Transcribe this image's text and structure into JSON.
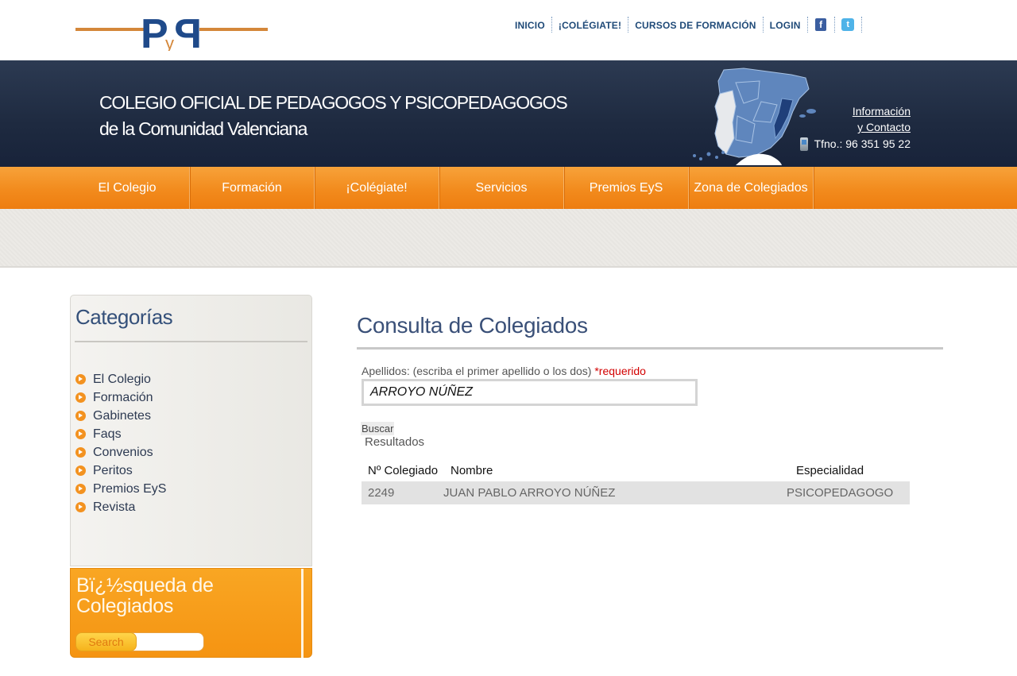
{
  "top_links": [
    "INICIO",
    "¡COLÉGIATE!",
    "CURSOS DE FORMACIÓN",
    "LOGIN"
  ],
  "social": [
    {
      "name": "facebook-icon",
      "glyph": "f",
      "color": "#3b5ea0"
    },
    {
      "name": "twitter-icon",
      "glyph": "t",
      "color": "#4fb3e8"
    }
  ],
  "logo": {
    "letters": "PyP",
    "colors": {
      "bar": "#d4873a",
      "letter": "#1f4a8a"
    }
  },
  "header": {
    "title_line1": "COLEGIO OFICIAL DE PEDAGOGOS Y PSICOPEDAGOGOS",
    "title_line2": "de la Comunidad Valenciana",
    "contact_line1": "Información",
    "contact_line2": "y Contacto",
    "phone": "Tfno.: 96 351 95 22"
  },
  "nav": [
    "El Colegio",
    "Formación",
    "¡Colégiate!",
    "Servicios",
    "Premios EyS",
    "Zona de Colegiados"
  ],
  "sidebar": {
    "title": "Categorías",
    "items": [
      "El Colegio",
      "Formación",
      "Gabinetes",
      "Faqs",
      "Convenios",
      "Peritos",
      "Premios EyS",
      "Revista"
    ]
  },
  "search_box": {
    "title_line1": "Bï¿½squeda de",
    "title_line2": "Colegiados",
    "button": "Search"
  },
  "main": {
    "title": "Consulta de Colegiados",
    "field_label": "Apellidos: (escriba el primer apellido o los dos)",
    "required": "*requerido",
    "field_value": "ARROYO NÚÑEZ",
    "buscar": "Buscar",
    "resultados": "Resultados",
    "table": {
      "headers": [
        "Nº Colegiado",
        "Nombre",
        "Especialidad"
      ],
      "rows": [
        [
          "2249",
          "JUAN PABLO ARROYO NÚÑEZ",
          "PSICOPEDAGOGO"
        ]
      ]
    }
  },
  "colors": {
    "orange": "#f28b1d",
    "navy": "#1e2a40",
    "title_blue": "#3a5078"
  }
}
